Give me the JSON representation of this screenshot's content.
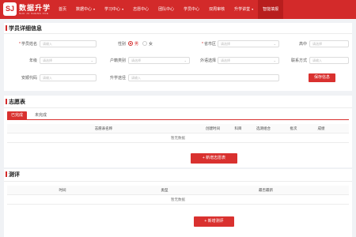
{
  "brand": {
    "mark": "SJ",
    "title": "数据升学",
    "subtitle": "SHU JU SHENG XUE"
  },
  "nav": {
    "items": [
      {
        "label": "首页",
        "dropdown": false,
        "active": false
      },
      {
        "label": "数据中心",
        "dropdown": true,
        "active": false
      },
      {
        "label": "学习中心",
        "dropdown": true,
        "active": false
      },
      {
        "label": "志愿中心",
        "dropdown": false,
        "active": false
      },
      {
        "label": "团队中心",
        "dropdown": false,
        "active": false
      },
      {
        "label": "学员中心",
        "dropdown": false,
        "active": false
      },
      {
        "label": "双周审核",
        "dropdown": false,
        "active": false
      },
      {
        "label": "升学讲堂",
        "dropdown": true,
        "active": false
      },
      {
        "label": "智能填报",
        "dropdown": false,
        "active": true
      }
    ]
  },
  "student_info": {
    "title": "学员详细信息",
    "name_label": "学员姓名",
    "name_placeholder": "请输入",
    "gender_label": "性别",
    "gender_male": "男",
    "gender_female": "女",
    "gender_selected": "男",
    "region_label": "省市区",
    "region_placeholder": "请选择",
    "school_label": "高中",
    "school_placeholder": "请选择",
    "grade_label": "年级",
    "grade_placeholder": "请选择",
    "hukou_label": "户籍类别",
    "hukou_placeholder": "请选择",
    "foreign_label": "外语选择",
    "foreign_placeholder": "请选择",
    "contact_label": "联系方式",
    "contact_placeholder": "请输入",
    "code_label": "安顺代码",
    "code_placeholder": "请输入",
    "path_label": "升学途径",
    "path_placeholder": "请输入",
    "save_button": "保存信息"
  },
  "volunteer": {
    "title": "志愿表",
    "tabs": [
      {
        "label": "已完成",
        "active": true
      },
      {
        "label": "未完成",
        "active": false
      }
    ],
    "columns": [
      "志愿表名称",
      "创建时间",
      "科目",
      "选测组合",
      "批次",
      "成绩"
    ],
    "empty_text": "暂无数据",
    "add_button": "+ 新增志愿表"
  },
  "assessment": {
    "title": "测评",
    "columns": [
      "时间",
      "类型",
      "最否最新"
    ],
    "empty_text": "暂无数据",
    "add_button": "+ 新增测评"
  },
  "colors": {
    "brand_red": "#d32a2a",
    "active_nav": "#b81e1e",
    "button_red": "#d9312f"
  }
}
